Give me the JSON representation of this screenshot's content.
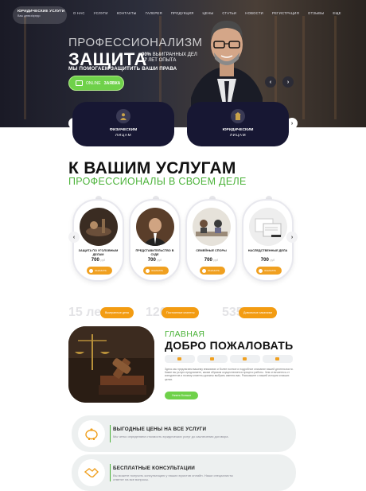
{
  "header": {
    "logo_title": "ЮРИДИЧЕСКИЕ УСЛУГИ",
    "logo_subtitle": "Ваш девиз/кредо",
    "nav": [
      "О нас",
      "Услуги",
      "Контакты",
      "Галерея",
      "Продукция",
      "Цены",
      "Статьи",
      "Новости",
      "Регистрация",
      "Отзывы",
      "Еще"
    ]
  },
  "hero": {
    "kicker": "ПРОФЕССИОНАЛИЗМ",
    "title": "ЗАЩИТА",
    "stat1_value": "90%",
    "stat1_label": "ВЫИГРАННЫХ ДЕЛ",
    "stat2_value": "27",
    "stat2_label": "ЛЕТ ОПЫТА",
    "subtitle": "МЫ ПОМОГАЕМ ЗАЩИТИТЬ ВАШИ ПРАВА",
    "cta_light": "ONLINE",
    "cta_bold": "ЗАЯВКА"
  },
  "client_cards": [
    {
      "line1": "ФИЗИЧЕСКИМ",
      "line2": "ЛИЦАМ"
    },
    {
      "line1": "ЮРИДИЧЕСКИМ",
      "line2": "ЛИЦАМ"
    }
  ],
  "services": {
    "title": "К ВАШИМ УСЛУГАМ",
    "subtitle": "ПРОФЕССИОНАЛЫ В СВОЕМ ДЕЛЕ",
    "items": [
      {
        "title": "ЗАЩИТА ПО УГОЛОВНЫМ ДЕЛАМ",
        "price": "700",
        "old": "руб",
        "button": "ЗАКАЗАТЬ"
      },
      {
        "title": "ПРЕДСТАВИТЕЛЬСТВО В СУДЕ",
        "price": "700",
        "old": "руб",
        "button": "ЗАКАЗАТЬ"
      },
      {
        "title": "СЕМЕЙНЫЕ СПОРЫ",
        "price": "700",
        "old": "руб",
        "button": "ЗАКАЗАТЬ"
      },
      {
        "title": "НАСЛЕДСТВЕННЫЕ ДЕЛА",
        "price": "700",
        "old": "руб",
        "button": "ЗАКАЗАТЬ"
      }
    ]
  },
  "counters": [
    {
      "value": "15 лет",
      "label": "Выигранные дела"
    },
    {
      "value": "120",
      "label": "Постоянные клиенты"
    },
    {
      "value": "535",
      "label": "Довольные заказчики"
    }
  ],
  "welcome": {
    "kicker": "ГЛАВНАЯ",
    "title": "ДОБРО ПОЖАЛОВАТЬ",
    "text": "Здесь мы предлагаем вашему вниманию и более полное и подробное описание вашей деятельности. Какие вы услуги предлагаете, каким образом осуществляется процесс работы. Чем отличаетесь от конкурентов и почему клиенты должны выбрать именно вас. Расскажите о вашей истории и ваших целях.",
    "button": "Узнать больше"
  },
  "features": [
    {
      "title": "ВЫГОДНЫЕ ЦЕНЫ НА ВСЕ УСЛУГИ",
      "text": "Мы четко определяем стоимость юридических услуг до заключения договора."
    },
    {
      "title": "БЕСПЛАТНЫЕ КОНСУЛЬТАЦИИ",
      "text": "Вы можете получить консультацию у наших юристов онлайн. Наши специалисты ответят на все вопросы."
    }
  ],
  "colors": {
    "accent_green": "#4cb33a",
    "accent_orange": "#f39c12",
    "navy": "#171733"
  }
}
